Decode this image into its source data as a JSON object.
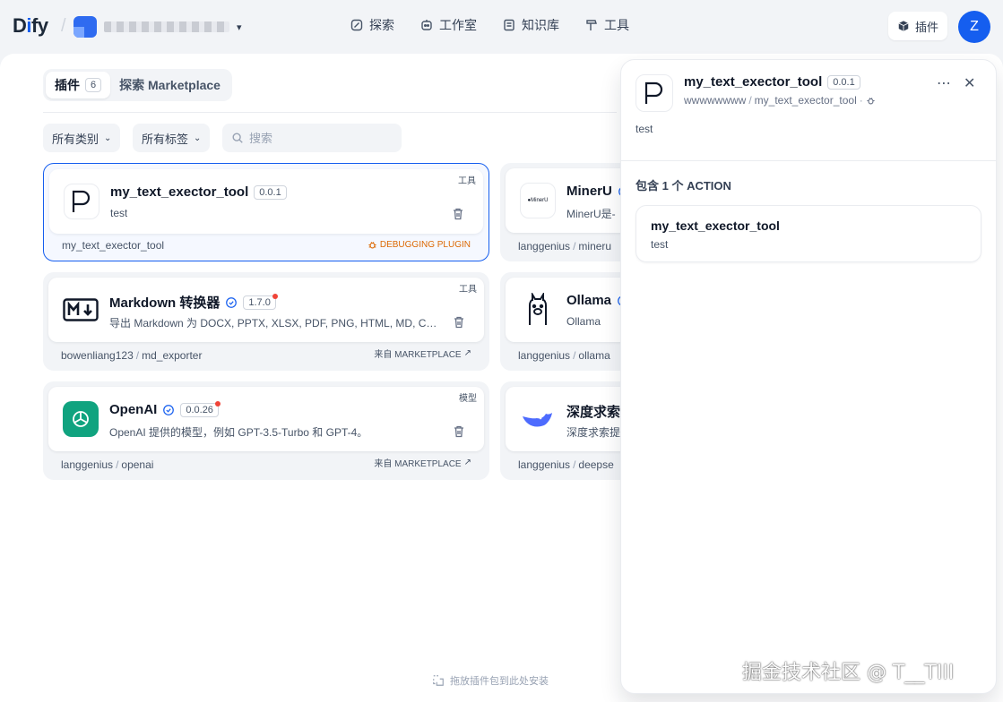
{
  "app": {
    "logo": "Dify"
  },
  "nav": [
    {
      "label": "探索",
      "icon": "compass-icon"
    },
    {
      "label": "工作室",
      "icon": "robot-icon"
    },
    {
      "label": "知识库",
      "icon": "book-icon"
    },
    {
      "label": "工具",
      "icon": "hammer-icon"
    }
  ],
  "header": {
    "plugins_label": "插件",
    "user_initial": "Z"
  },
  "tabs": [
    {
      "label": "插件",
      "count": "6"
    },
    {
      "label": "探索 Marketplace"
    }
  ],
  "filters": {
    "category": "所有类别",
    "tags": "所有标签",
    "search_placeholder": "搜索"
  },
  "cards": [
    {
      "name": "my_text_exector_tool",
      "version": "0.0.1",
      "desc": "test",
      "type": "工具",
      "org": "",
      "pkg": "my_text_exector_tool",
      "badge": "DEBUGGING PLUGIN"
    },
    {
      "name": "MinerU",
      "desc": "MinerU是-",
      "org": "langgenius",
      "pkg": "mineru"
    },
    {
      "name": "Markdown 转换器",
      "version": "1.7.0",
      "desc": "导出 Markdown 为 DOCX, PPTX, XLSX, PDF, PNG, HTML, MD, CS...",
      "type": "工具",
      "org": "bowenliang123",
      "pkg": "md_exporter",
      "badge": "来自 MARKETPLACE"
    },
    {
      "name": "Ollama",
      "desc": "Ollama",
      "org": "langgenius",
      "pkg": "ollama"
    },
    {
      "name": "OpenAI",
      "version": "0.0.26",
      "desc": "OpenAI 提供的模型，例如 GPT-3.5-Turbo 和 GPT-4。",
      "type": "模型",
      "org": "langgenius",
      "pkg": "openai",
      "badge": "来自 MARKETPLACE"
    },
    {
      "name": "深度求索",
      "desc": "深度求索提",
      "org": "langgenius",
      "pkg": "deepse"
    }
  ],
  "drop_hint": "拖放插件包到此处安装",
  "drawer": {
    "title": "my_text_exector_tool",
    "version": "0.0.1",
    "org": "wwwwwwww",
    "pkg": "my_text_exector_tool",
    "desc": "test",
    "actions_title": "包含 1 个 ACTION",
    "actions": [
      {
        "name": "my_text_exector_tool",
        "desc": "test"
      }
    ]
  },
  "watermark": "掘金技术社区 @ T__TIII",
  "colors": {
    "accent": "#155eef",
    "debug": "#dc6803",
    "openai": "#10a37f",
    "badge_dot": "#f04438"
  }
}
